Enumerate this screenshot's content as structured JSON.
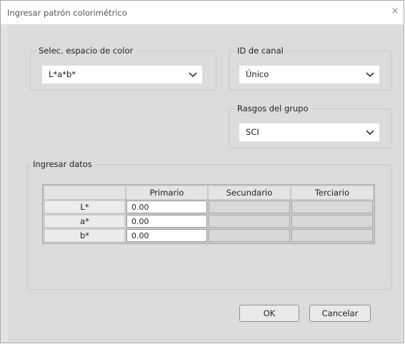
{
  "window": {
    "title": "Ingresar patrón colorimétrico",
    "close_glyph": "×"
  },
  "color_space": {
    "group_label": "Selec. espacio de color",
    "selected": "L*a*b*"
  },
  "channel": {
    "group_label": "ID de canal",
    "selected": "Único"
  },
  "group_features": {
    "group_label": "Rasgos del grupo",
    "selected": "SCI"
  },
  "data_entry": {
    "group_label": "Ingresar datos",
    "columns": [
      "Primario",
      "Secundario",
      "Terciario"
    ],
    "rows": [
      {
        "label": "L*",
        "values": [
          "0.00",
          "",
          ""
        ]
      },
      {
        "label": "a*",
        "values": [
          "0.00",
          "",
          ""
        ]
      },
      {
        "label": "b*",
        "values": [
          "0.00",
          "",
          ""
        ]
      }
    ]
  },
  "buttons": {
    "ok": "OK",
    "cancel": "Cancelar"
  }
}
